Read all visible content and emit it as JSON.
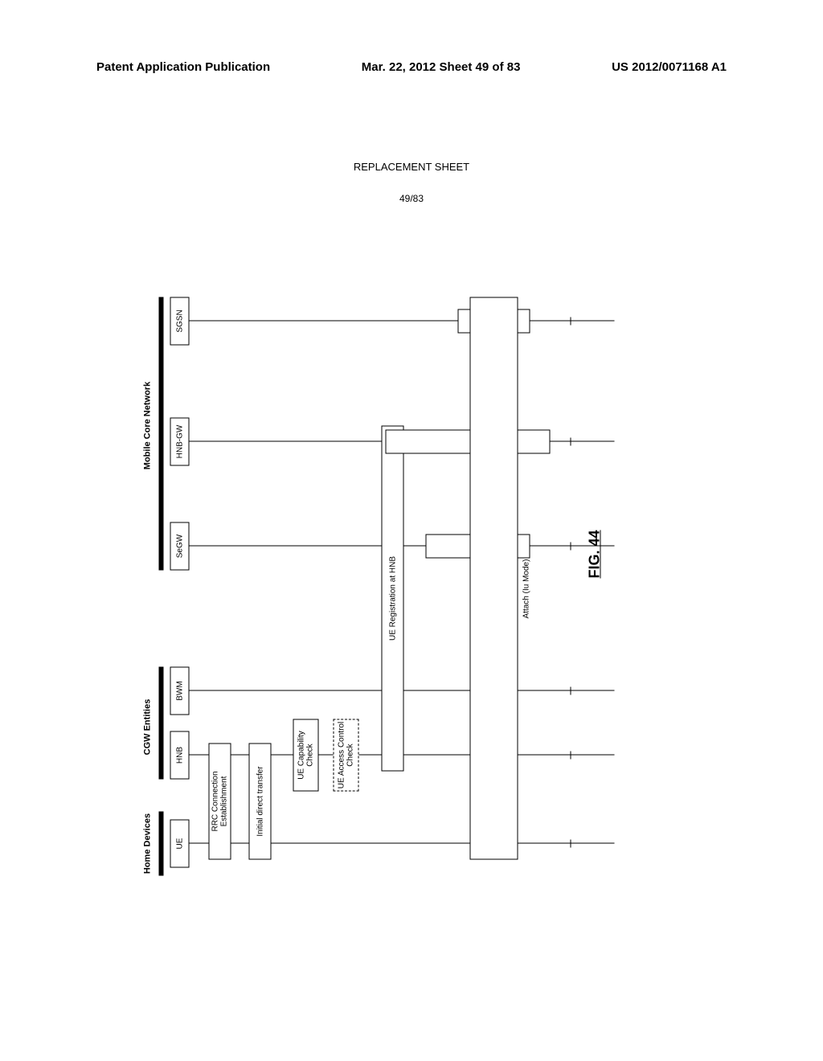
{
  "header": {
    "left": "Patent Application Publication",
    "center": "Mar. 22, 2012  Sheet 49 of 83",
    "right": "US 2012/0071168 A1"
  },
  "replacement": "REPLACEMENT SHEET",
  "sheet_num": "49/83",
  "fig_label": "FIG. 44",
  "groups": {
    "home": "Home Devices",
    "cgw": "CGW Entities",
    "core": "Mobile Core Network"
  },
  "actors": {
    "ue": "UE",
    "hnb": "HNB",
    "bwm": "BWM",
    "segw": "SeGW",
    "hnbgw": "HNB-GW",
    "sgsn": "SGSN"
  },
  "procs": {
    "rrc": "RRC Connection Establishment",
    "idt": "Initial direct transfer",
    "cap": "UE Capability Check",
    "acc": "UE Access Control Check",
    "reg": "UE Registration at HNB",
    "attach": "Attach (Iu Mode)"
  }
}
